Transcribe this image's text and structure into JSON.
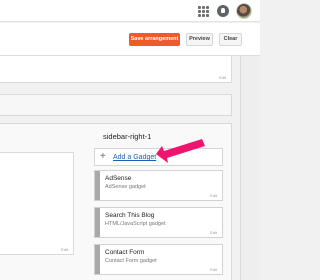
{
  "toolbar": {
    "save_label": "Save arrangement",
    "preview_label": "Preview",
    "clear_label": "Clear"
  },
  "layout": {
    "edit_label": "Edit"
  },
  "sidebar": {
    "title": "sidebar-right-1",
    "add_gadget_label": "Add a Gadget",
    "gadgets": [
      {
        "title": "AdSense",
        "subtitle": "AdSense gadget"
      },
      {
        "title": "Search This Blog",
        "subtitle": "HTML/JavaScript gadget"
      },
      {
        "title": "Contact Form",
        "subtitle": "Contact Form gadget"
      }
    ]
  },
  "icons": {
    "apps": "apps-grid-icon",
    "notifications": "notifications-icon",
    "account": "avatar",
    "add": "plus-icon",
    "pointer": "arrow-annotation"
  },
  "colors": {
    "primary_button": "#f05a2a",
    "link": "#1a5fb4",
    "annotation_arrow": "#f0146e"
  }
}
